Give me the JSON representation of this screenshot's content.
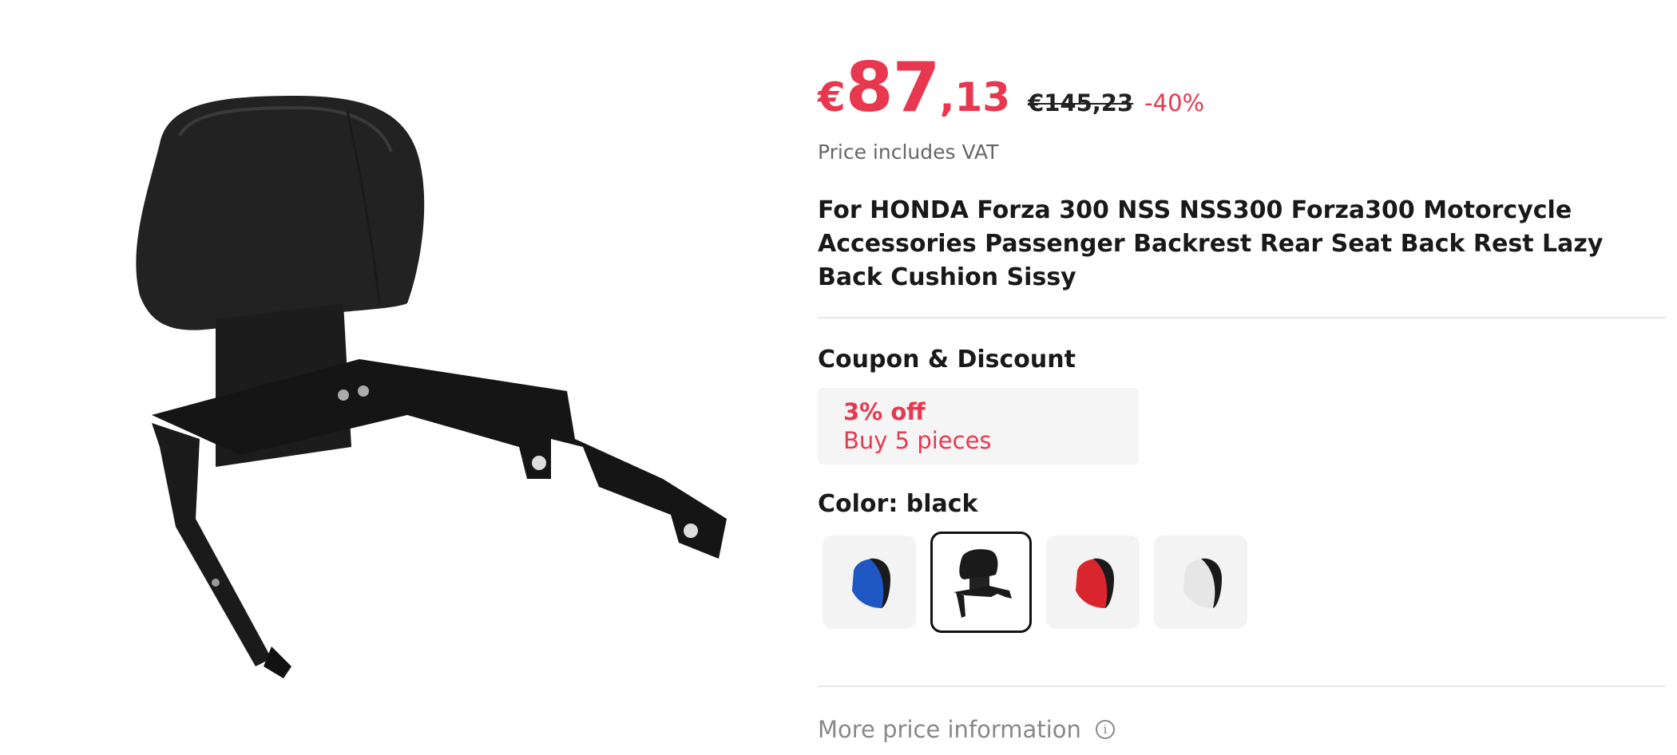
{
  "price": {
    "currency": "€",
    "integer": "87",
    "decimal": ",13",
    "original": "€145,23",
    "discount": "-40%",
    "vat_note": "Price includes VAT"
  },
  "product": {
    "title": "For HONDA Forza 300 NSS NSS300 Forza300 Motorcycle Accessories Passenger Backrest Rear Seat Back Rest Lazy Back Cushion Sissy"
  },
  "coupon": {
    "section_label": "Coupon & Discount",
    "title": "3% off",
    "subtitle": "Buy 5 pieces"
  },
  "color": {
    "label": "Color: black",
    "options": [
      {
        "name": "blue",
        "accent": "#1f57c3",
        "selected": false
      },
      {
        "name": "black",
        "accent": "#1a1a1a",
        "selected": true
      },
      {
        "name": "red",
        "accent": "#d9262e",
        "selected": false
      },
      {
        "name": "white",
        "accent": "#e8e8e8",
        "selected": false
      }
    ]
  },
  "footer": {
    "more_price_info": "More price information",
    "info_icon": "info-circle-icon"
  },
  "colors": {
    "accent": "#e8384f",
    "text": "#191919",
    "muted": "#888888"
  }
}
